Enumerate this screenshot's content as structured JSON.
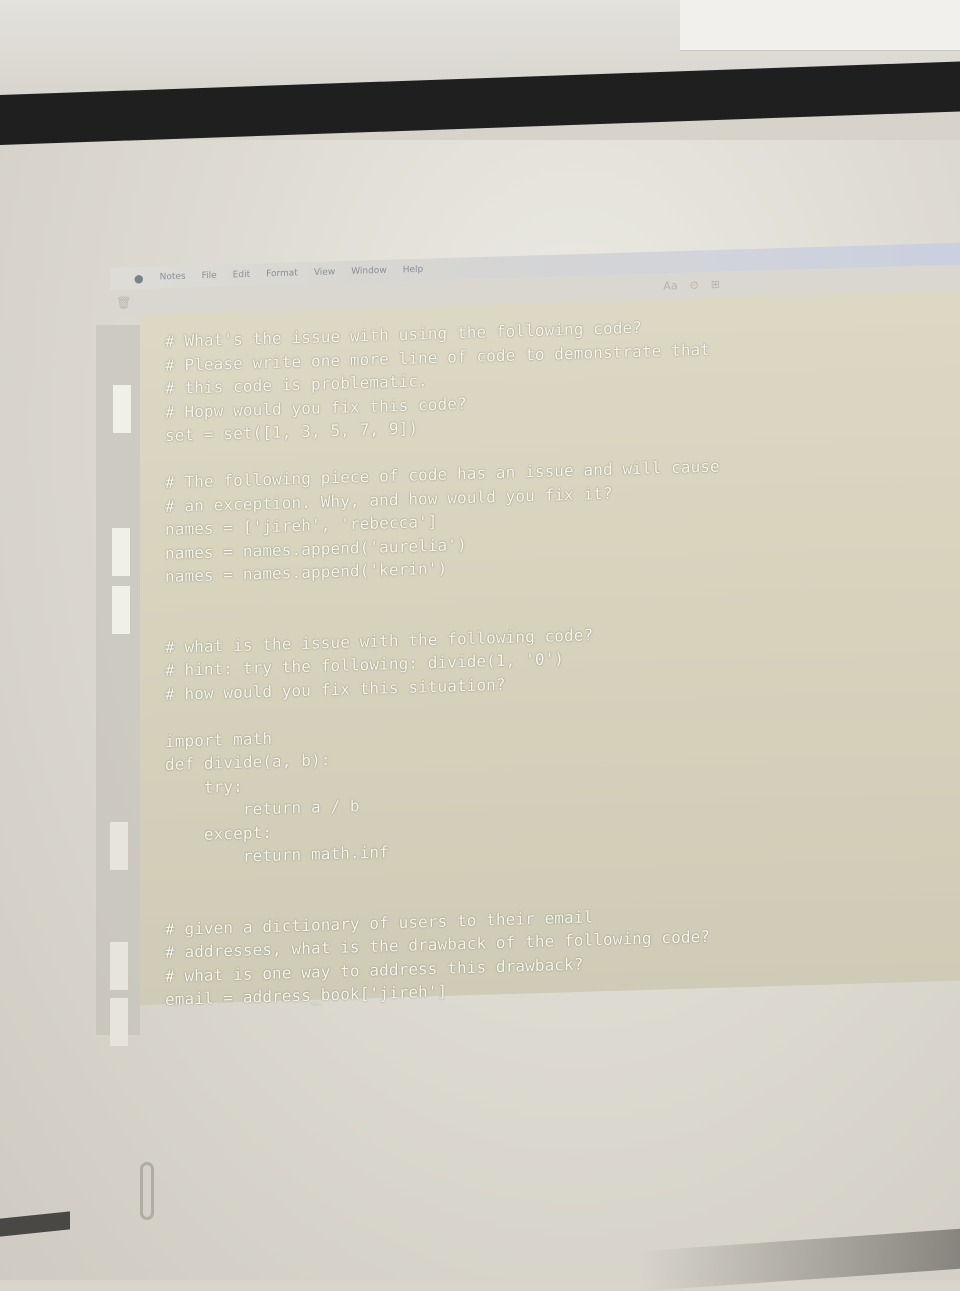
{
  "menubar": {
    "apple_icon": "apple-icon",
    "items": [
      "Notes",
      "File",
      "Edit",
      "Format",
      "View",
      "Window",
      "Help"
    ]
  },
  "toolbar": {
    "icons": [
      "Aa",
      "⊙",
      "⊞"
    ]
  },
  "note": {
    "lines": [
      "# What's the issue with using the following code?",
      "# Please write one more line of code to demonstrate that",
      "# this code is problematic.",
      "# Hopw would you fix this code?",
      "set = set([1, 3, 5, 7, 9])",
      "",
      "# The following piece of code has an issue and will cause",
      "# an exception. Why, and how would you fix it?",
      "names = ['jireh', 'rebecca']",
      "names = names.append('aurelia')",
      "names = names.append('kerin')",
      "",
      "",
      "# what is the issue with the following code?",
      "# hint: try the following: divide(1, '0')",
      "# how would you fix this situation?",
      "",
      "import math",
      "def divide(a, b):",
      "    try:",
      "        return a / b",
      "    except:",
      "        return math.inf",
      "",
      "",
      "# given a dictionary of users to their email",
      "# addresses, what is the drawback of the following code?",
      "# what is one way to address this drawback?",
      "email = address_book['jireh']"
    ]
  }
}
